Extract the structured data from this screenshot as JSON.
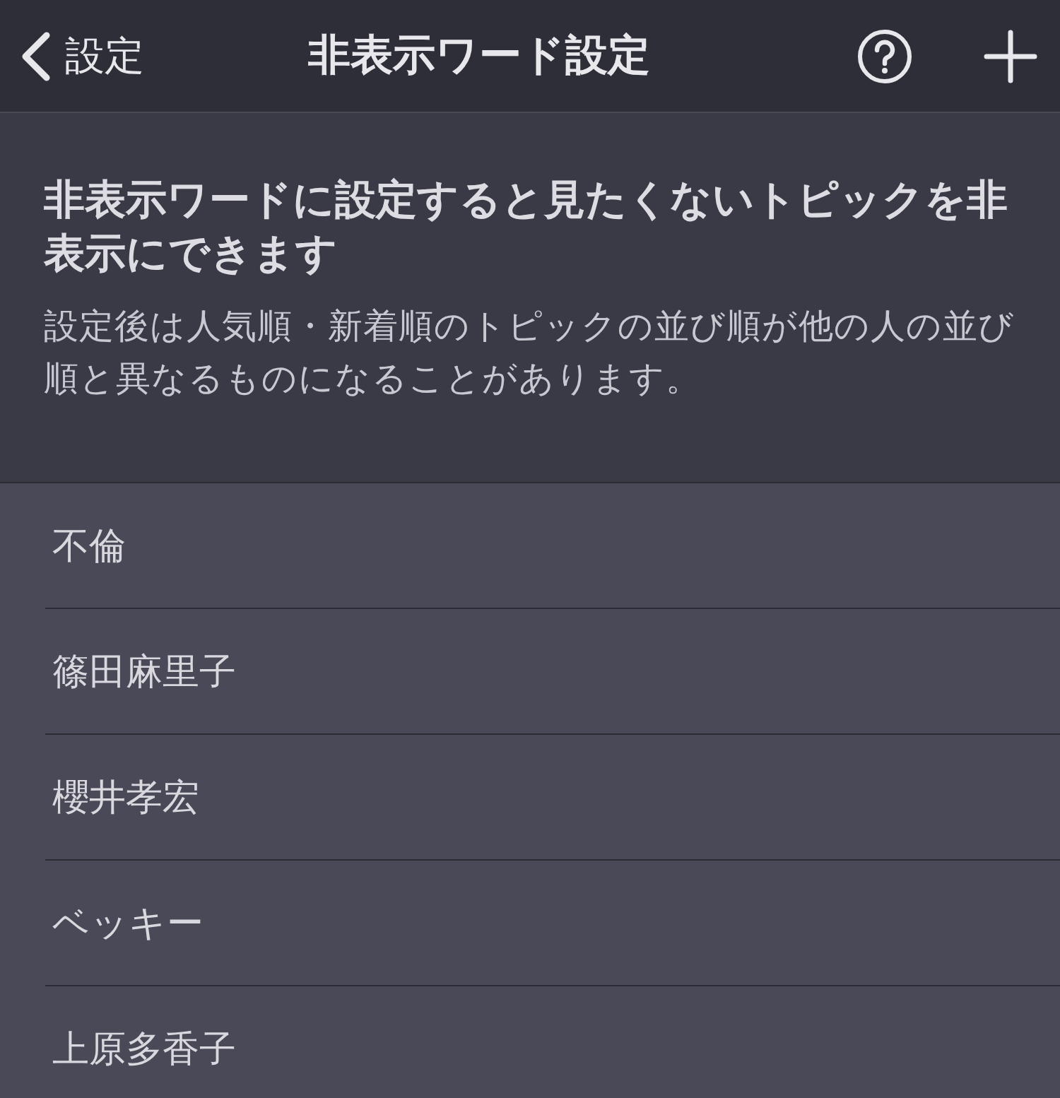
{
  "nav": {
    "back_label": "設定",
    "title": "非表示ワード設定"
  },
  "info": {
    "heading": "非表示ワードに設定すると見たくないトピックを非表示にできます",
    "body": "設定後は人気順・新着順のトピックの並び順が他の人の並び順と異なるものになることがあります。"
  },
  "words": [
    "不倫",
    "篠田麻里子",
    "櫻井孝宏",
    "ベッキー",
    "上原多香子"
  ]
}
